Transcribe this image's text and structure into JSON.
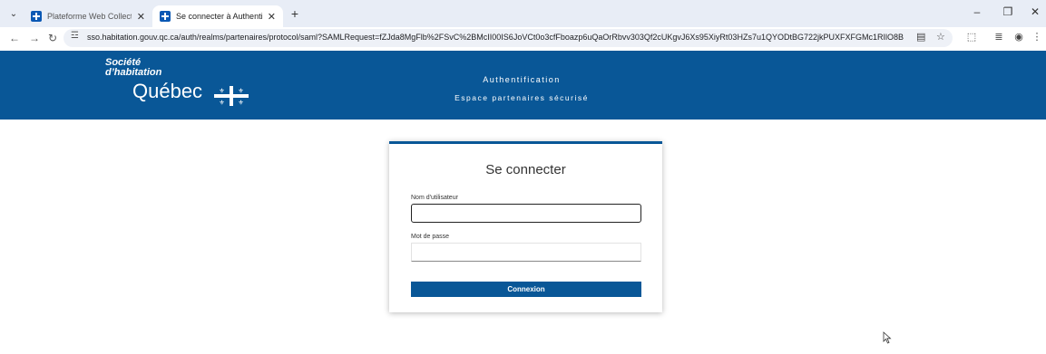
{
  "browser": {
    "tabs": [
      {
        "title": "Plateforme Web Collecte des dé"
      },
      {
        "title": "Se connecter à Authentification"
      }
    ],
    "url": "sso.habitation.gouv.qc.ca/auth/realms/partenaires/protocol/saml?SAMLRequest=fZJda8MgFlb%2FSvC%2BMcII00IS6JoVCt0o3cfFboazp6uQaOrRbvv303Qf2cUKgvJ6Xs95XiyRt03HZs7u1QYODtBG722jkPUXFXFGMc1RIlO8BWRWsLvZzYplccl6o60Wu..."
  },
  "header": {
    "logo_line1": "Société",
    "logo_line2": "d’habitation",
    "logo_line3": "Québec",
    "title": "Authentification",
    "subtitle": "Espace partenaires sécurisé"
  },
  "login": {
    "title": "Se connecter",
    "username_label": "Nom d'utilisateur",
    "username_value": "",
    "password_label": "Mot de passe",
    "password_value": "",
    "submit_label": "Connexion"
  },
  "colors": {
    "brand_blue": "#095797",
    "tabstrip_bg": "#e8edf6"
  }
}
